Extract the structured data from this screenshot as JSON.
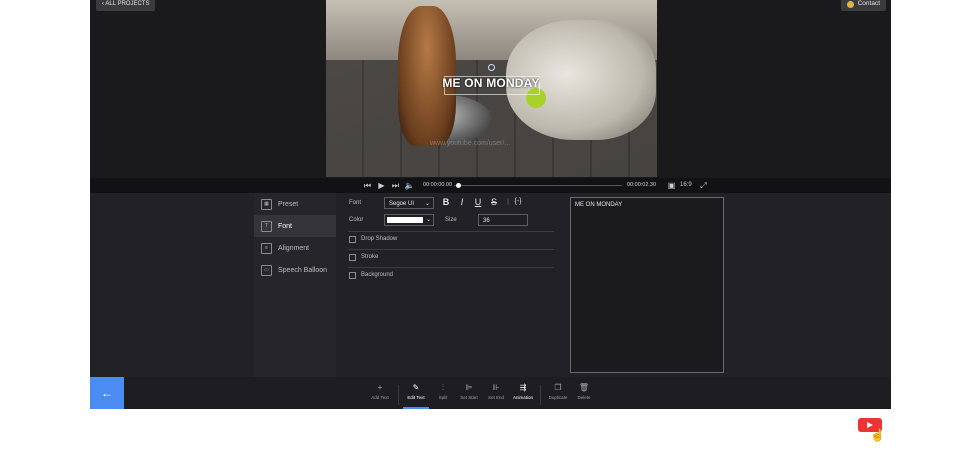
{
  "header": {
    "back_label": "ALL PROJECTS",
    "contact_label": "Contact"
  },
  "video": {
    "caption": "ME ON MONDAY",
    "watermark": "www.youtube.com/user/..."
  },
  "transport": {
    "current_time": "00:00:00.00",
    "end_time": "00:00:02.30",
    "aspect_ratio": "16:9"
  },
  "sidebar": {
    "items": [
      {
        "label": "Preset",
        "icon": "preset-icon"
      },
      {
        "label": "Font",
        "icon": "font-icon"
      },
      {
        "label": "Alignment",
        "icon": "alignment-icon"
      },
      {
        "label": "Speech Balloon",
        "icon": "speech-balloon-icon"
      }
    ]
  },
  "font_panel": {
    "font_label": "Font",
    "font_value": "Segoe UI",
    "color_label": "Color",
    "color_value": "#ffffff",
    "size_label": "Size",
    "size_value": "36",
    "options": [
      {
        "label": "Drop Shadow",
        "checked": false
      },
      {
        "label": "Stroke",
        "checked": false
      },
      {
        "label": "Background",
        "checked": false
      }
    ]
  },
  "text_editor": {
    "value": "ME ON MONDAY"
  },
  "toolbar": {
    "items": [
      {
        "label": "Add Text",
        "icon": "plus-icon"
      },
      {
        "label": "Edit Text",
        "icon": "edit-icon"
      },
      {
        "label": "Split",
        "icon": "split-icon"
      },
      {
        "label": "Set Start",
        "icon": "set-start-icon"
      },
      {
        "label": "Set End",
        "icon": "set-end-icon"
      },
      {
        "label": "Animation",
        "icon": "animation-icon"
      },
      {
        "label": "Duplicate",
        "icon": "duplicate-icon"
      },
      {
        "label": "Delete",
        "icon": "delete-icon"
      }
    ]
  },
  "colors": {
    "accent": "#4b8cf2",
    "panel": "#222226"
  }
}
